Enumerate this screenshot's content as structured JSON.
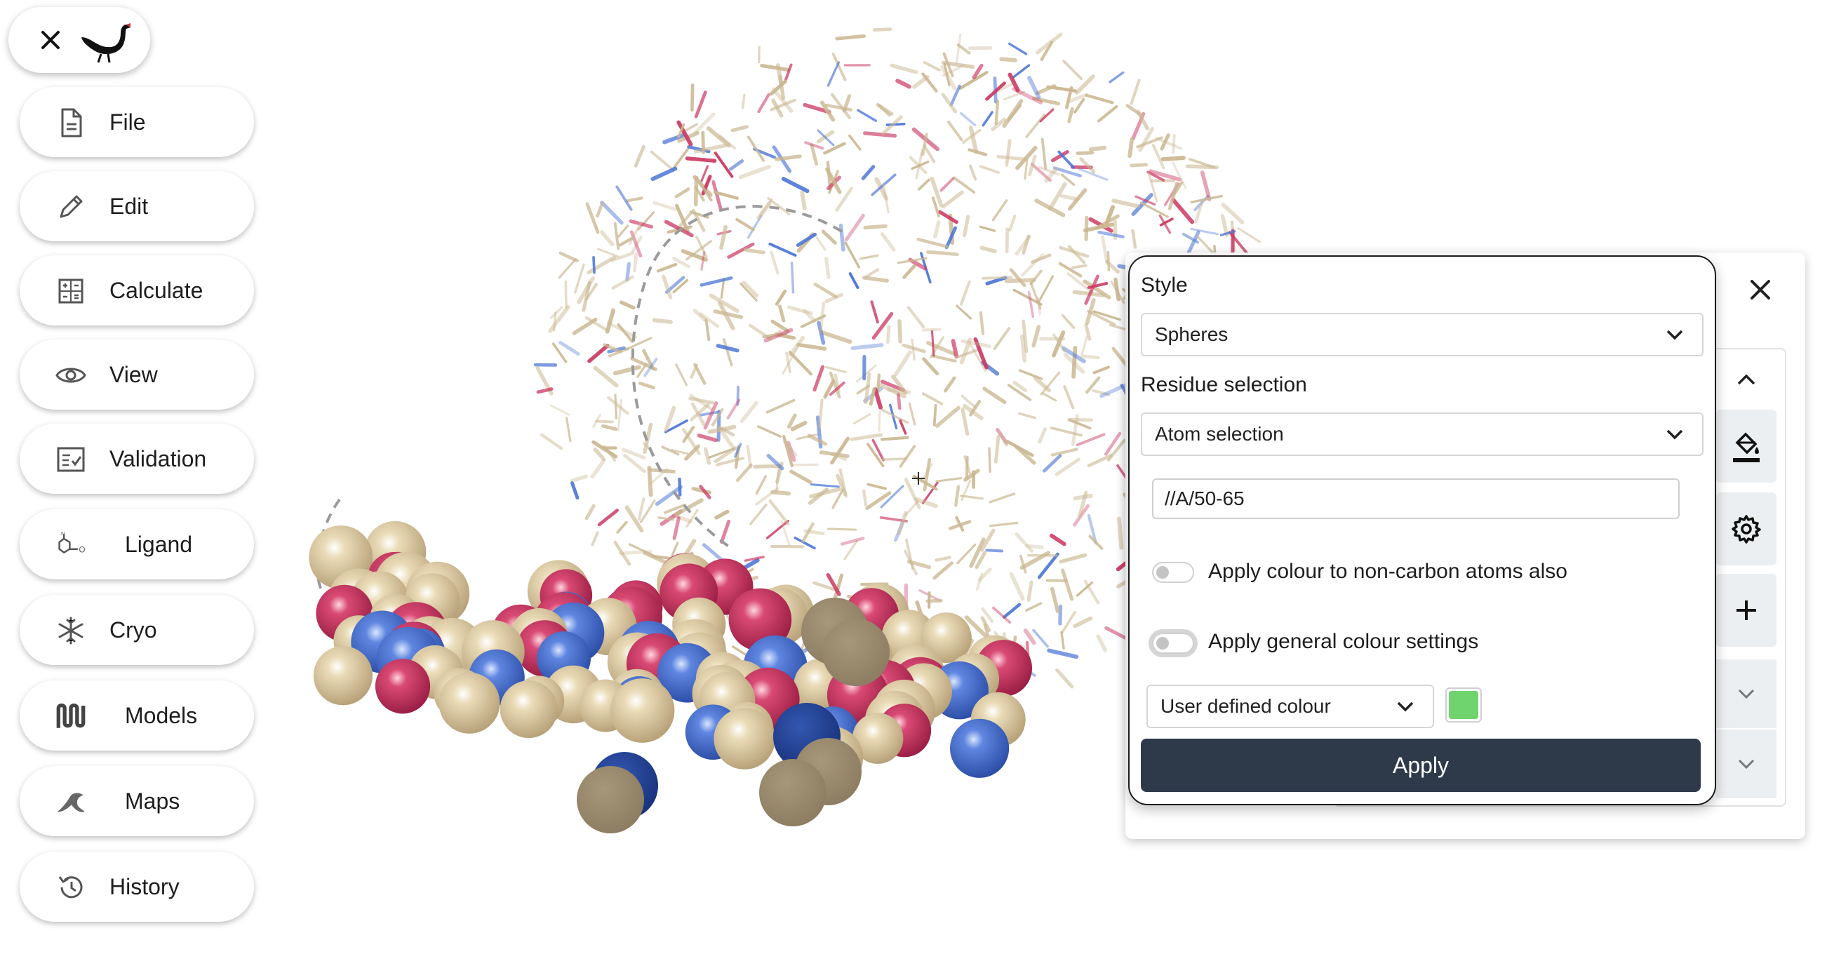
{
  "app": {
    "brand": "Moorhen"
  },
  "colors": {
    "carbon": "#d4c29a",
    "oxygen": "#cc3a63",
    "nitrogen": "#4c76d6",
    "dark_carbon": "#9a8a6e",
    "dark_nitrogen": "#1f3f94",
    "apply_button": "#2e3a4a",
    "user_colour": "#6fd46e"
  },
  "sidebar": {
    "items": [
      {
        "label": "File",
        "icon": "file-icon"
      },
      {
        "label": "Edit",
        "icon": "pencil-icon"
      },
      {
        "label": "Calculate",
        "icon": "calculator-icon"
      },
      {
        "label": "View",
        "icon": "eye-icon"
      },
      {
        "label": "Validation",
        "icon": "checklist-icon"
      },
      {
        "label": "Ligand",
        "icon": "ligand-icon"
      },
      {
        "label": "Cryo",
        "icon": "snowflake-icon"
      },
      {
        "label": "Models",
        "icon": "models-icon"
      },
      {
        "label": "Maps",
        "icon": "maps-icon"
      },
      {
        "label": "History",
        "icon": "history-icon"
      }
    ]
  },
  "popup": {
    "style_label": "Style",
    "style_value": "Spheres",
    "residue_label": "Residue selection",
    "residue_value": "Atom selection",
    "cid_value": "//A/50-65",
    "toggle1_label": "Apply colour to non-carbon atoms also",
    "toggle2_label": "Apply general colour settings",
    "colour_mode": "User defined colour",
    "apply_label": "Apply"
  },
  "panel": {
    "tools": [
      "paint-bucket-icon",
      "gear-icon",
      "plus-icon",
      "chevron-down-icon",
      "chevron-down-icon"
    ]
  }
}
